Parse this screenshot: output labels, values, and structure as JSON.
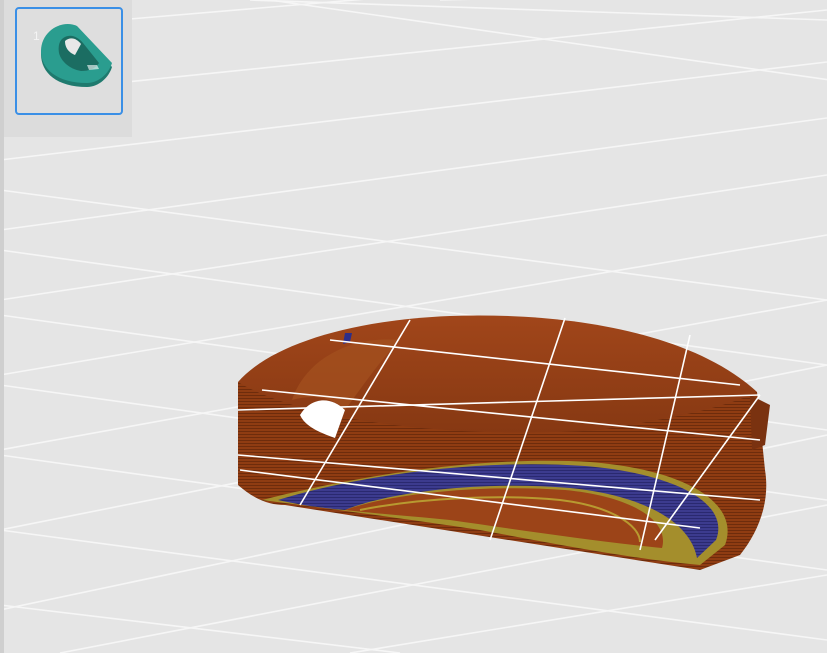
{
  "plate_list": {
    "items": [
      {
        "index": "1",
        "selected": true,
        "thumbnail_color": "#2a9d8f"
      }
    ]
  },
  "viewport": {
    "background_color": "#e5e5e5",
    "grid_color": "#f7f7f7",
    "model_colors": {
      "outer_wall": "#8b3a12",
      "infill": "#3b3a8c",
      "inner_wall": "#9a8a2a"
    }
  }
}
